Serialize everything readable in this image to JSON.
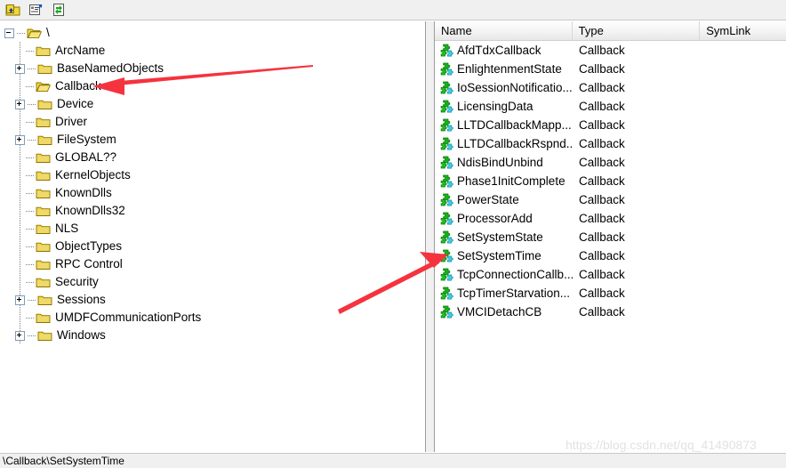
{
  "toolbar": {
    "buttons": [
      {
        "name": "up-folder-icon",
        "label": "Up"
      },
      {
        "name": "properties-icon",
        "label": "Properties"
      },
      {
        "name": "refresh-icon",
        "label": "Refresh"
      }
    ]
  },
  "tree": {
    "root": {
      "label": "\\",
      "expander": "minus",
      "icon": "folder-open"
    },
    "items": [
      {
        "label": "ArcName",
        "expander": "none",
        "icon": "folder"
      },
      {
        "label": "BaseNamedObjects",
        "expander": "plus",
        "icon": "folder"
      },
      {
        "label": "Callback",
        "expander": "none",
        "icon": "folder-open",
        "selected": true
      },
      {
        "label": "Device",
        "expander": "plus",
        "icon": "folder"
      },
      {
        "label": "Driver",
        "expander": "none",
        "icon": "folder"
      },
      {
        "label": "FileSystem",
        "expander": "plus",
        "icon": "folder"
      },
      {
        "label": "GLOBAL??",
        "expander": "none",
        "icon": "folder"
      },
      {
        "label": "KernelObjects",
        "expander": "none",
        "icon": "folder"
      },
      {
        "label": "KnownDlls",
        "expander": "none",
        "icon": "folder"
      },
      {
        "label": "KnownDlls32",
        "expander": "none",
        "icon": "folder"
      },
      {
        "label": "NLS",
        "expander": "none",
        "icon": "folder"
      },
      {
        "label": "ObjectTypes",
        "expander": "none",
        "icon": "folder"
      },
      {
        "label": "RPC Control",
        "expander": "none",
        "icon": "folder"
      },
      {
        "label": "Security",
        "expander": "none",
        "icon": "folder"
      },
      {
        "label": "Sessions",
        "expander": "plus",
        "icon": "folder"
      },
      {
        "label": "UMDFCommunicationPorts",
        "expander": "none",
        "icon": "folder"
      },
      {
        "label": "Windows",
        "expander": "plus",
        "icon": "folder"
      }
    ]
  },
  "list": {
    "columns": [
      "Name",
      "Type",
      "SymLink"
    ],
    "rows": [
      {
        "name": "AfdTdxCallback",
        "type": "Callback",
        "symlink": ""
      },
      {
        "name": "EnlightenmentState",
        "type": "Callback",
        "symlink": ""
      },
      {
        "name": "IoSessionNotificatio...",
        "type": "Callback",
        "symlink": ""
      },
      {
        "name": "LicensingData",
        "type": "Callback",
        "symlink": ""
      },
      {
        "name": "LLTDCallbackMapp...",
        "type": "Callback",
        "symlink": ""
      },
      {
        "name": "LLTDCallbackRspnd...",
        "type": "Callback",
        "symlink": ""
      },
      {
        "name": "NdisBindUnbind",
        "type": "Callback",
        "symlink": ""
      },
      {
        "name": "Phase1InitComplete",
        "type": "Callback",
        "symlink": ""
      },
      {
        "name": "PowerState",
        "type": "Callback",
        "symlink": ""
      },
      {
        "name": "ProcessorAdd",
        "type": "Callback",
        "symlink": ""
      },
      {
        "name": "SetSystemState",
        "type": "Callback",
        "symlink": ""
      },
      {
        "name": "SetSystemTime",
        "type": "Callback",
        "symlink": ""
      },
      {
        "name": "TcpConnectionCallb...",
        "type": "Callback",
        "symlink": ""
      },
      {
        "name": "TcpTimerStarvation...",
        "type": "Callback",
        "symlink": ""
      },
      {
        "name": "VMCIDetachCB",
        "type": "Callback",
        "symlink": ""
      }
    ]
  },
  "statusbar": {
    "text": "\\Callback\\SetSystemTime"
  },
  "watermark": {
    "text": "https://blog.csdn.net/qq_41490873"
  },
  "annotations": {
    "arrow_color": "#F5333F",
    "arrows": [
      {
        "name": "arrow-to-callback",
        "target": "Callback"
      },
      {
        "name": "arrow-to-setsystemtime",
        "target": "SetSystemTime"
      }
    ]
  },
  "colors": {
    "folder": "#F2D73B",
    "panel_bg": "#ffffff",
    "chrome_bg": "#f0f0f0"
  }
}
